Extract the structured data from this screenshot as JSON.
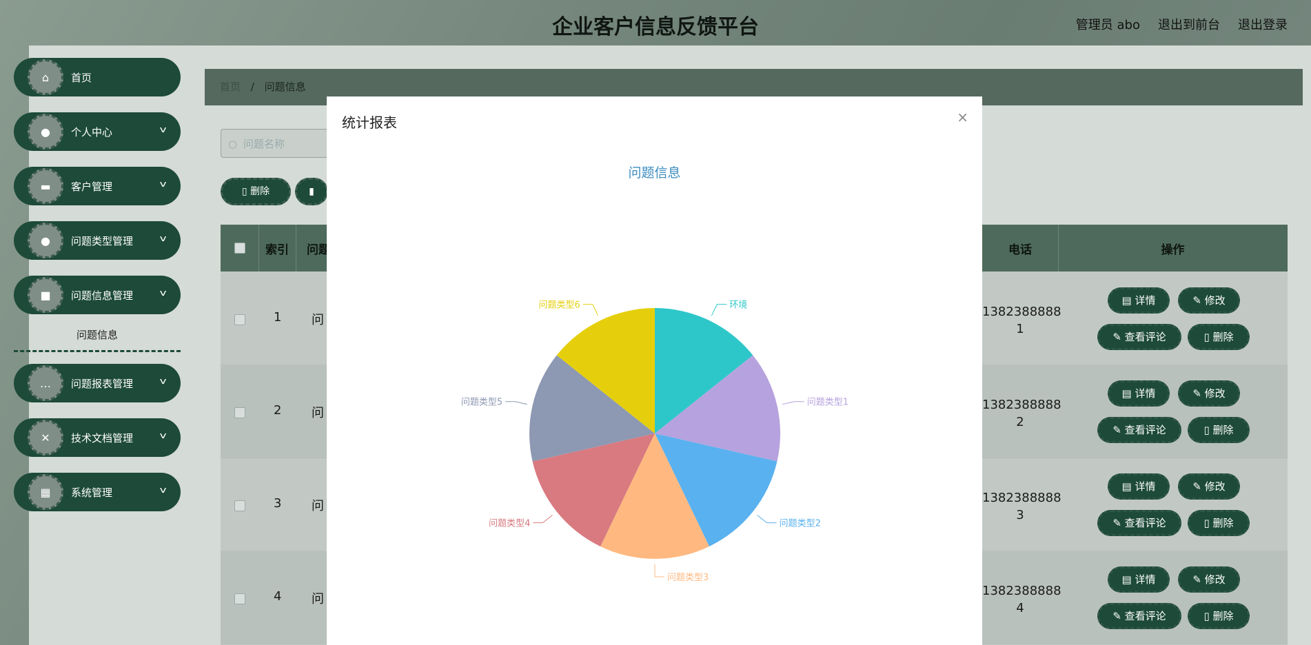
{
  "header": {
    "title": "企业客户信息反馈平台",
    "admin": "管理员 abo",
    "to_front": "退出到前台",
    "logout": "退出登录"
  },
  "sidebar": {
    "items": [
      {
        "label": "首页",
        "icon": "home-icon",
        "expandable": false
      },
      {
        "label": "个人中心",
        "icon": "user-icon",
        "expandable": true
      },
      {
        "label": "客户管理",
        "icon": "monitor-icon",
        "expandable": true
      },
      {
        "label": "问题类型管理",
        "icon": "user-icon",
        "expandable": true
      },
      {
        "label": "问题信息管理",
        "icon": "book-icon",
        "expandable": true
      },
      {
        "label": "问题报表管理",
        "icon": "chat-icon",
        "expandable": true
      },
      {
        "label": "技术文档管理",
        "icon": "ticket-icon",
        "expandable": true
      },
      {
        "label": "系统管理",
        "icon": "grid-icon",
        "expandable": true
      }
    ],
    "sub_item": "问题信息"
  },
  "breadcrumb": {
    "home": "首页",
    "sep": "/",
    "current": "问题信息"
  },
  "search": {
    "placeholder": "问题名称"
  },
  "toolbar": {
    "delete": "删除"
  },
  "table": {
    "headers": {
      "index": "索引",
      "name_partial": "问题",
      "phone": "电话",
      "ops": "操作"
    },
    "rows": [
      {
        "index": "1",
        "name_partial": "问",
        "phone_line1": "1382388888",
        "phone_line2": "1"
      },
      {
        "index": "2",
        "name_partial": "问",
        "phone_line1": "1382388888",
        "phone_line2": "2"
      },
      {
        "index": "3",
        "name_partial": "问",
        "phone_line1": "1382388888",
        "phone_line2": "3"
      },
      {
        "index": "4",
        "name_partial": "问",
        "phone_line1": "1382388888",
        "phone_line2": "4"
      }
    ],
    "actions": {
      "detail": "详情",
      "edit": "修改",
      "comments": "查看评论",
      "delete": "删除"
    }
  },
  "modal": {
    "title": "统计报表",
    "close": "×"
  },
  "chart_data": {
    "type": "pie",
    "title": "问题信息",
    "series": [
      {
        "label": "环境",
        "value": 1,
        "color": "#2ec7c9"
      },
      {
        "label": "问题类型1",
        "value": 1,
        "color": "#b6a2de"
      },
      {
        "label": "问题类型2",
        "value": 1,
        "color": "#5ab1ef"
      },
      {
        "label": "问题类型3",
        "value": 1,
        "color": "#ffb980"
      },
      {
        "label": "问题类型4",
        "value": 1,
        "color": "#d87a80"
      },
      {
        "label": "问题类型5",
        "value": 1,
        "color": "#8d98b3"
      },
      {
        "label": "问题类型6",
        "value": 1,
        "color": "#e5cf0d"
      }
    ]
  }
}
